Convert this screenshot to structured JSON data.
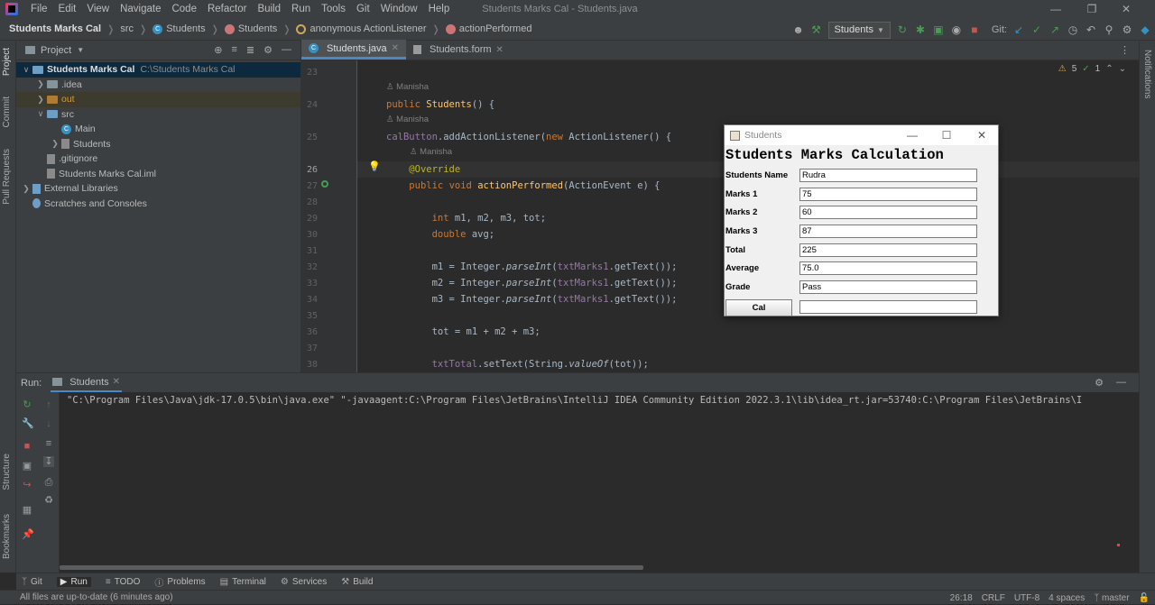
{
  "window": {
    "menus": [
      "File",
      "Edit",
      "View",
      "Navigate",
      "Code",
      "Refactor",
      "Build",
      "Run",
      "Tools",
      "Git",
      "Window",
      "Help"
    ],
    "title": "Students Marks Cal - Students.java"
  },
  "breadcrumb": [
    "Students Marks Cal",
    "src",
    "Students",
    "Students",
    "anonymous ActionListener",
    "actionPerformed"
  ],
  "toolbar": {
    "run_config": "Students",
    "git_label": "Git:"
  },
  "project": {
    "header": "Project",
    "tree": [
      {
        "label": "Students Marks Cal",
        "extra": "C:\\Students Marks Cal",
        "depth": 0,
        "kind": "folder-blue",
        "expanded": true
      },
      {
        "label": ".idea",
        "depth": 1,
        "kind": "folder",
        "expanded": false
      },
      {
        "label": "out",
        "depth": 1,
        "kind": "folder-orange",
        "expanded": false
      },
      {
        "label": "src",
        "depth": 1,
        "kind": "folder-blue",
        "expanded": true
      },
      {
        "label": "Main",
        "depth": 2,
        "kind": "class",
        "expanded": null
      },
      {
        "label": "Students",
        "depth": 2,
        "kind": "form",
        "expanded": false
      },
      {
        "label": ".gitignore",
        "depth": 1,
        "kind": "file",
        "expanded": null
      },
      {
        "label": "Students Marks Cal.iml",
        "depth": 1,
        "kind": "file",
        "expanded": null
      },
      {
        "label": "External Libraries",
        "depth": 0,
        "kind": "lib",
        "expanded": false
      },
      {
        "label": "Scratches and Consoles",
        "depth": 0,
        "kind": "scratch",
        "expanded": null
      }
    ]
  },
  "editor": {
    "tabs": [
      {
        "label": "Students.java",
        "active": true
      },
      {
        "label": "Students.form",
        "active": false
      }
    ],
    "inspections": {
      "warnings": "5",
      "ok": "1"
    },
    "author_hint": "Manisha",
    "lines": [
      {
        "no": "23",
        "code": ""
      },
      {
        "no": "24",
        "code": "public Students() {"
      },
      {
        "no": "25",
        "code": "calButton.addActionListener(new ActionListener() {"
      },
      {
        "no": "26",
        "code": "    @Override"
      },
      {
        "no": "27",
        "code": "    public void actionPerformed(ActionEvent e) {"
      },
      {
        "no": "28",
        "code": ""
      },
      {
        "no": "29",
        "code": "        int m1, m2, m3, tot;"
      },
      {
        "no": "30",
        "code": "        double avg;"
      },
      {
        "no": "31",
        "code": ""
      },
      {
        "no": "32",
        "code": "        m1 = Integer.parseInt(txtMarks1.getText());"
      },
      {
        "no": "33",
        "code": "        m2 = Integer.parseInt(txtMarks1.getText());"
      },
      {
        "no": "34",
        "code": "        m3 = Integer.parseInt(txtMarks1.getText());"
      },
      {
        "no": "35",
        "code": ""
      },
      {
        "no": "36",
        "code": "        tot = m1 + m2 + m3;"
      },
      {
        "no": "37",
        "code": ""
      },
      {
        "no": "38",
        "code": "        txtTotal.setText(String.valueOf(tot));"
      }
    ]
  },
  "dialog": {
    "title": "Students",
    "heading": "Students Marks Calculation",
    "fields": [
      {
        "label": "Students Name",
        "value": "Rudra"
      },
      {
        "label": "Marks 1",
        "value": "75"
      },
      {
        "label": "Marks 2",
        "value": "60"
      },
      {
        "label": "Marks 3",
        "value": "87"
      },
      {
        "label": "Total",
        "value": "225"
      },
      {
        "label": "Average",
        "value": "75.0"
      },
      {
        "label": "Grade",
        "value": "Pass"
      }
    ],
    "button": "Cal",
    "result_value": ""
  },
  "run": {
    "label": "Run:",
    "tab": "Students",
    "command": "\"C:\\Program Files\\Java\\jdk-17.0.5\\bin\\java.exe\" \"-javaagent:C:\\Program Files\\JetBrains\\IntelliJ IDEA Community Edition 2022.3.1\\lib\\idea_rt.jar=53740:C:\\Program Files\\JetBrains\\I"
  },
  "side_tabs": {
    "left_top": [
      "Project",
      "Commit",
      "Pull Requests"
    ],
    "left_bottom": [
      "Structure",
      "Bookmarks"
    ],
    "right": [
      "Notifications"
    ]
  },
  "bottom_tabs": [
    "Git",
    "Run",
    "TODO",
    "Problems",
    "Terminal",
    "Services",
    "Build"
  ],
  "status": {
    "message": "All files are up-to-date (6 minutes ago)",
    "position": "26:18",
    "line_sep": "CRLF",
    "encoding": "UTF-8",
    "indent": "4 spaces",
    "branch": "master"
  }
}
